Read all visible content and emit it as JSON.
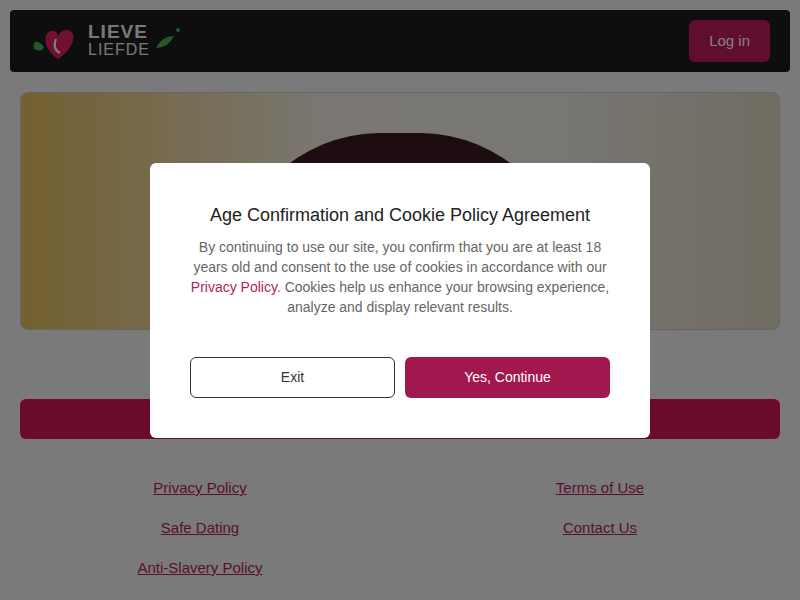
{
  "header": {
    "logo": {
      "line1": "LIEVE",
      "line2": "LIEFDE"
    },
    "login_button": "Log in"
  },
  "modal": {
    "title": "Age Confirmation and Cookie Policy Agreement",
    "body_before_link": "By continuing to use our site, you confirm that you are at least 18 years old and consent to the use of cookies in accordance with our ",
    "link": "Privacy Policy",
    "body_after_link": ". Cookies help us enhance your browsing experience, analyze and display relevant results.",
    "buttons": [
      {
        "label": "Exit",
        "kind": "outline"
      },
      {
        "label": "Yes, Continue",
        "kind": "primary"
      }
    ]
  },
  "footer": {
    "left_links": [
      "Privacy Policy",
      "Safe Dating",
      "Anti-Slavery Policy"
    ],
    "right_links": [
      "Terms of Use",
      "Contact Us"
    ]
  }
}
